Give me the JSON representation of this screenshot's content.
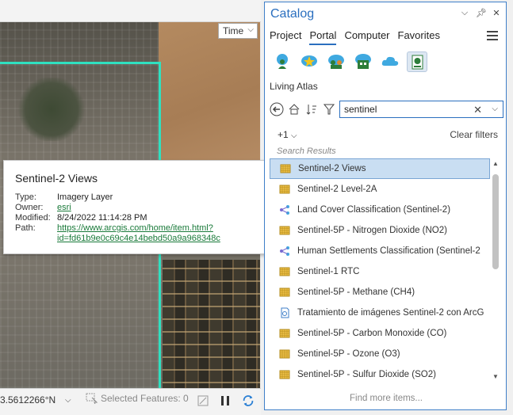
{
  "map": {
    "time_dropdown": "Time",
    "coordinates": "3.5612266°N",
    "selected_features": "Selected Features: 0"
  },
  "popup": {
    "title": "Sentinel-2 Views",
    "rows": [
      {
        "key": "Type:",
        "value": "Imagery Layer"
      },
      {
        "key": "Owner:",
        "value": "esri"
      },
      {
        "key": "Modified:",
        "value": "8/24/2022 11:14:28 PM"
      },
      {
        "key": "Path:",
        "value": "https://www.arcgis.com/home/item.html?"
      },
      {
        "key": "",
        "value": "id=fd61b9e0c69c4e14bebd50a9a968348c"
      }
    ]
  },
  "catalog": {
    "title": "Catalog",
    "tabs": [
      "Project",
      "Portal",
      "Computer",
      "Favorites"
    ],
    "active_tab": "Portal",
    "section": "Living Atlas",
    "search_value": "sentinel",
    "filter_count": "+1",
    "clear_filters": "Clear filters",
    "results_label": "Search Results",
    "results": [
      {
        "label": "Sentinel-2 Views",
        "icon": "imagery-layer-icon"
      },
      {
        "label": "Sentinel-2 Level-2A",
        "icon": "imagery-layer-icon"
      },
      {
        "label": "Land Cover Classification (Sentinel-2)",
        "icon": "deep-learning-package-icon"
      },
      {
        "label": "Sentinel-5P - Nitrogen Dioxide (NO2)",
        "icon": "imagery-layer-icon"
      },
      {
        "label": "Human Settlements Classification (Sentinel-2",
        "icon": "deep-learning-package-icon"
      },
      {
        "label": "Sentinel-1 RTC",
        "icon": "imagery-layer-icon"
      },
      {
        "label": "Sentinel-5P - Methane (CH4)",
        "icon": "imagery-layer-icon"
      },
      {
        "label": "Tratamiento de imágenes Sentinel-2 con ArcG",
        "icon": "story-document-icon"
      },
      {
        "label": "Sentinel-5P - Carbon Monoxide (CO)",
        "icon": "imagery-layer-icon"
      },
      {
        "label": "Sentinel-5P - Ozone (O3)",
        "icon": "imagery-layer-icon"
      },
      {
        "label": "Sentinel-5P - Sulfur Dioxide (SO2)",
        "icon": "imagery-layer-icon"
      }
    ],
    "find_more": "Find more items..."
  }
}
